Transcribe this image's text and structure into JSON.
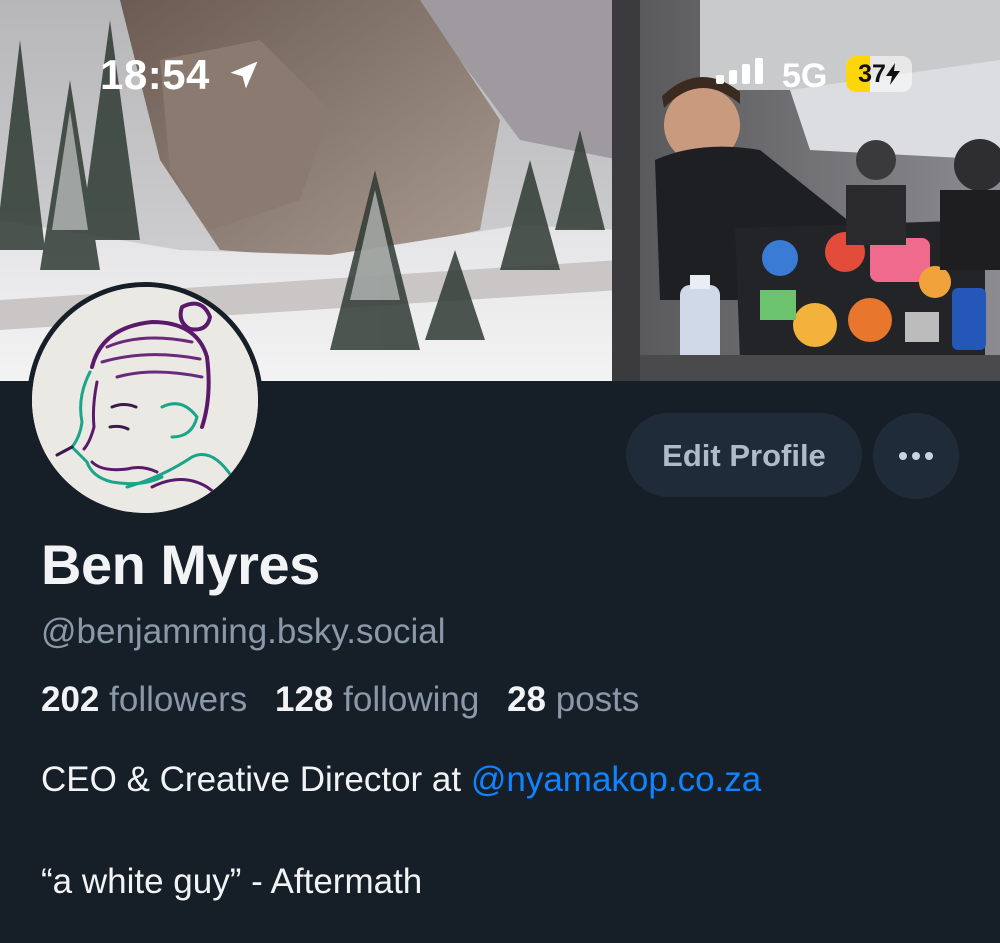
{
  "status_bar": {
    "time": "18:54",
    "network": "5G",
    "battery_level": "37",
    "battery_percent": 37,
    "icons": [
      "location-arrow-icon",
      "cellular-signal-icon",
      "battery-charging-icon"
    ]
  },
  "banner": {
    "description_icon": "banner-photo"
  },
  "buttons": {
    "edit_profile": "Edit Profile",
    "more_icon": "ellipsis-icon"
  },
  "profile": {
    "display_name": "Ben Myres",
    "handle": "@benjamming.bsky.social",
    "stats": [
      {
        "value": "202",
        "label": "followers"
      },
      {
        "value": "128",
        "label": "following"
      },
      {
        "value": "28",
        "label": "posts"
      }
    ],
    "bio": {
      "line1_text": "CEO & Creative Director at ",
      "line1_mention": "@nyamakop.co.za",
      "line2": "“a white guy” - Aftermath"
    }
  },
  "colors": {
    "background": "#161e27",
    "button_bg": "#1f2b38",
    "muted_text": "#8a98a8",
    "link": "#1083fe",
    "battery": "#ffd60a"
  }
}
